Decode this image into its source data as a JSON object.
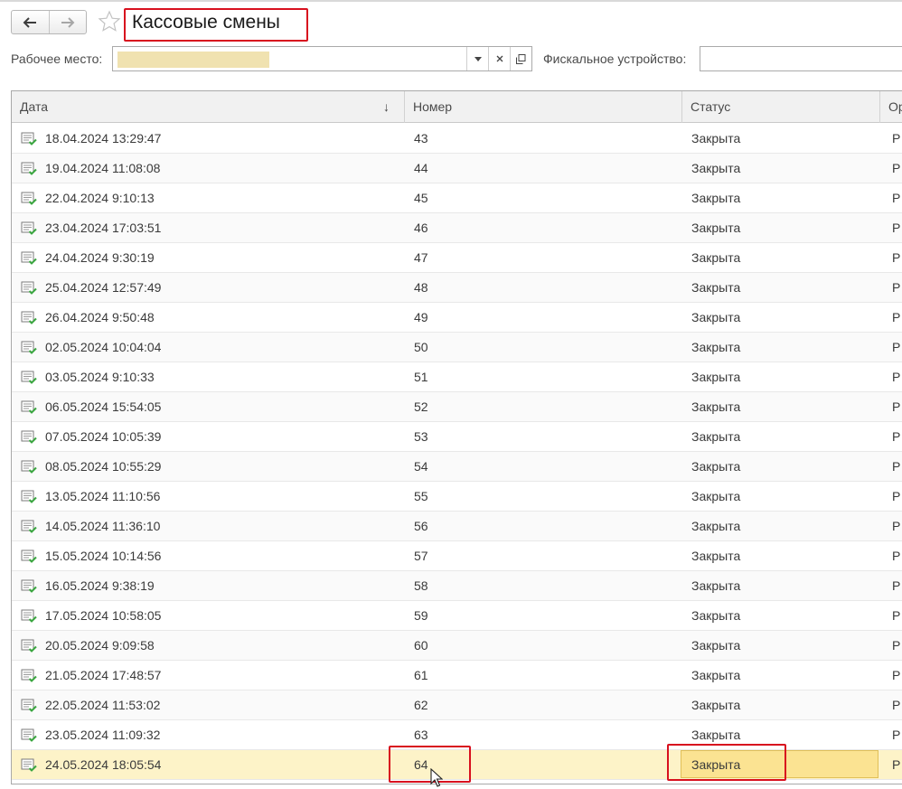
{
  "window": {
    "title": "Кассовые смены"
  },
  "nav": {
    "back_label": "Назад",
    "forward_label": "Вперёд"
  },
  "filters": {
    "workplace_label": "Рабочее место:",
    "workplace_value": "",
    "fiscal_label": "Фискальное устройство:",
    "fiscal_value": ""
  },
  "table": {
    "columns": [
      "Дата",
      "Номер",
      "Статус",
      "Ор"
    ],
    "sort_indicator": "↓",
    "rows": [
      {
        "date": "18.04.2024 13:29:47",
        "number": "43",
        "status": "Закрыта",
        "org": "Р"
      },
      {
        "date": "19.04.2024 11:08:08",
        "number": "44",
        "status": "Закрыта",
        "org": "Р"
      },
      {
        "date": "22.04.2024 9:10:13",
        "number": "45",
        "status": "Закрыта",
        "org": "Р"
      },
      {
        "date": "23.04.2024 17:03:51",
        "number": "46",
        "status": "Закрыта",
        "org": "Р"
      },
      {
        "date": "24.04.2024 9:30:19",
        "number": "47",
        "status": "Закрыта",
        "org": "Р"
      },
      {
        "date": "25.04.2024 12:57:49",
        "number": "48",
        "status": "Закрыта",
        "org": "Р"
      },
      {
        "date": "26.04.2024 9:50:48",
        "number": "49",
        "status": "Закрыта",
        "org": "Р"
      },
      {
        "date": "02.05.2024 10:04:04",
        "number": "50",
        "status": "Закрыта",
        "org": "Р"
      },
      {
        "date": "03.05.2024 9:10:33",
        "number": "51",
        "status": "Закрыта",
        "org": "Р"
      },
      {
        "date": "06.05.2024 15:54:05",
        "number": "52",
        "status": "Закрыта",
        "org": "Р"
      },
      {
        "date": "07.05.2024 10:05:39",
        "number": "53",
        "status": "Закрыта",
        "org": "Р"
      },
      {
        "date": "08.05.2024 10:55:29",
        "number": "54",
        "status": "Закрыта",
        "org": "Р"
      },
      {
        "date": "13.05.2024 11:10:56",
        "number": "55",
        "status": "Закрыта",
        "org": "Р"
      },
      {
        "date": "14.05.2024 11:36:10",
        "number": "56",
        "status": "Закрыта",
        "org": "Р"
      },
      {
        "date": "15.05.2024 10:14:56",
        "number": "57",
        "status": "Закрыта",
        "org": "Р"
      },
      {
        "date": "16.05.2024 9:38:19",
        "number": "58",
        "status": "Закрыта",
        "org": "Р"
      },
      {
        "date": "17.05.2024 10:58:05",
        "number": "59",
        "status": "Закрыта",
        "org": "Р"
      },
      {
        "date": "20.05.2024 9:09:58",
        "number": "60",
        "status": "Закрыта",
        "org": "Р"
      },
      {
        "date": "21.05.2024 17:48:57",
        "number": "61",
        "status": "Закрыта",
        "org": "Р"
      },
      {
        "date": "22.05.2024 11:53:02",
        "number": "62",
        "status": "Закрыта",
        "org": "Р"
      },
      {
        "date": "23.05.2024 11:09:32",
        "number": "63",
        "status": "Закрыта",
        "org": "Р"
      },
      {
        "date": "24.05.2024 18:05:54",
        "number": "64",
        "status": "Закрыта",
        "org": "Р",
        "selected": true
      }
    ]
  },
  "colors": {
    "highlight_red": "#d8101e",
    "selected_row": "#fdf3c8",
    "selected_cell": "#fbe392",
    "doc_icon_green": "#3aa640"
  },
  "icons": {
    "back": "arrow-left-icon",
    "forward": "arrow-right-icon",
    "favorite": "star-icon",
    "dropdown": "chevron-down-icon",
    "clear": "close-icon",
    "open": "open-window-icon",
    "row": "document-posted-icon",
    "pointer": "mouse-pointer-icon"
  }
}
